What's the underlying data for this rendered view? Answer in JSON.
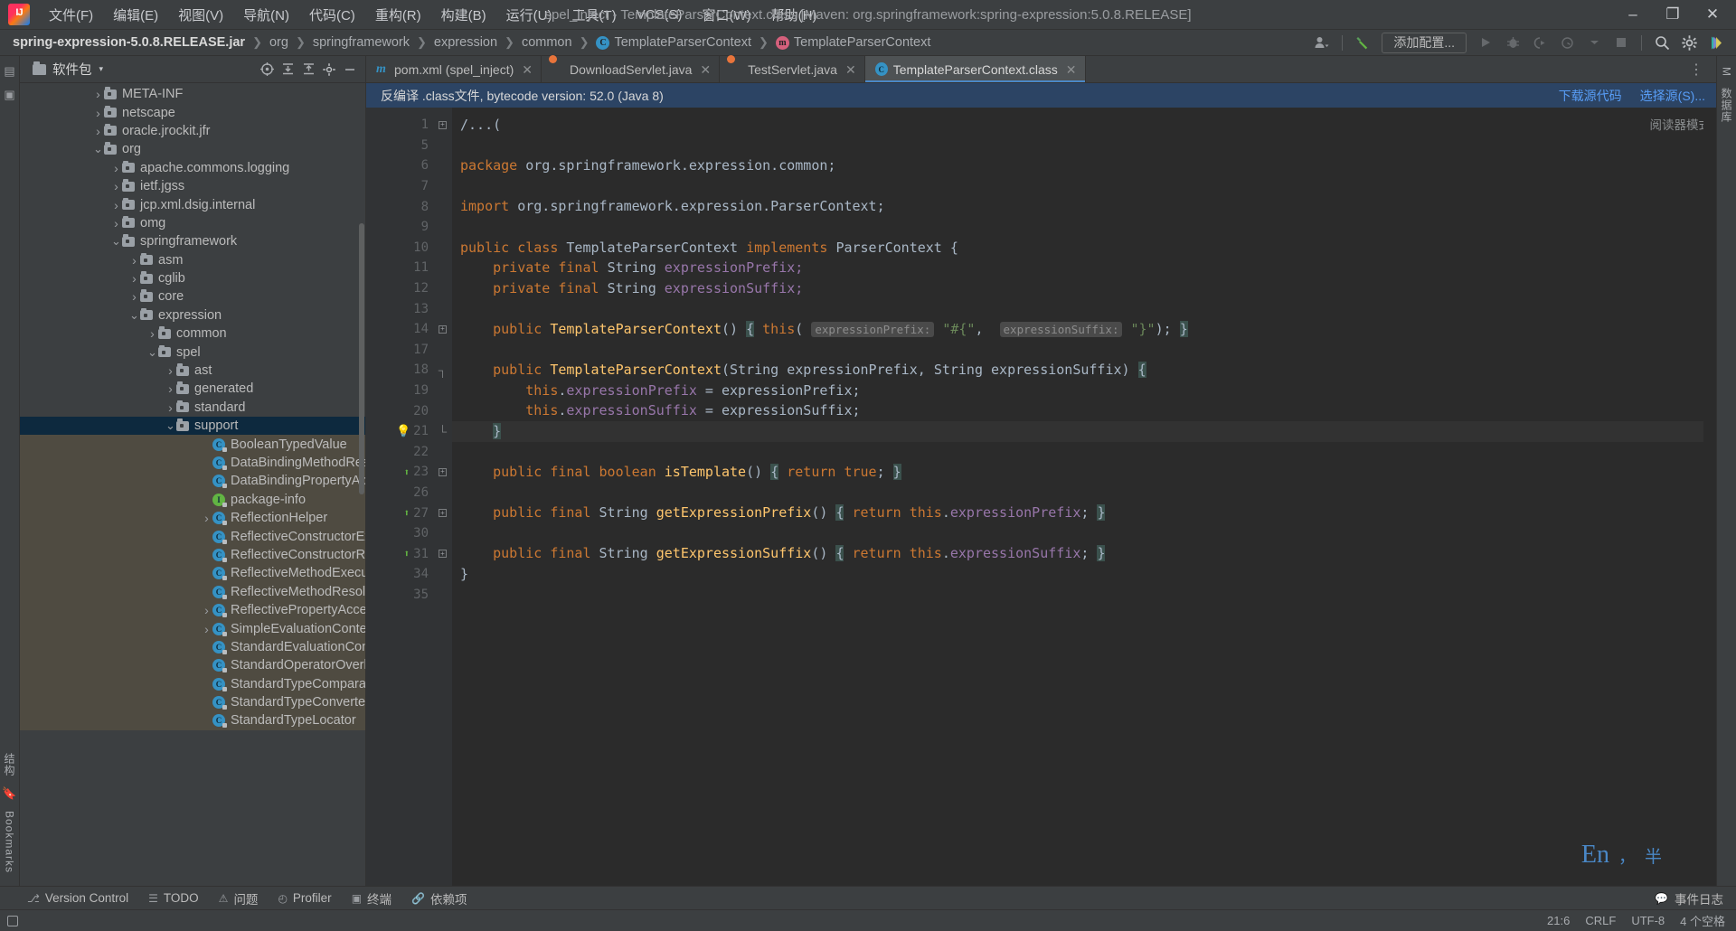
{
  "window": {
    "title": "spel_inject - TemplateParserContext.class [Maven: org.springframework:spring-expression:5.0.8.RELEASE]",
    "minimize": "–",
    "maximize": "❐",
    "close": "✕"
  },
  "menu": {
    "items": [
      {
        "label": "文件(F)"
      },
      {
        "label": "编辑(E)"
      },
      {
        "label": "视图(V)"
      },
      {
        "label": "导航(N)"
      },
      {
        "label": "代码(C)"
      },
      {
        "label": "重构(R)"
      },
      {
        "label": "构建(B)"
      },
      {
        "label": "运行(U)"
      },
      {
        "label": "工具(T)"
      },
      {
        "label": "VCS(S)"
      },
      {
        "label": "窗口(W)"
      },
      {
        "label": "帮助(H)"
      }
    ]
  },
  "navbar": {
    "crumbs": [
      {
        "label": "spring-expression-5.0.8.RELEASE.jar",
        "icon": "none",
        "root": true
      },
      {
        "label": "org",
        "icon": "none"
      },
      {
        "label": "springframework",
        "icon": "none"
      },
      {
        "label": "expression",
        "icon": "none"
      },
      {
        "label": "common",
        "icon": "none"
      },
      {
        "label": "TemplateParserContext",
        "icon": "class-icon",
        "glyph": "C"
      },
      {
        "label": "TemplateParserContext",
        "icon": "method-icon",
        "glyph": "m"
      }
    ],
    "separator": "❯",
    "run_config_label": "添加配置...",
    "buttons": [
      {
        "name": "user-account-icon",
        "glyph": "👤"
      },
      {
        "name": "build-hammer-icon",
        "glyph": "🔨"
      },
      {
        "name": "run-icon",
        "glyph": "▶"
      },
      {
        "name": "debug-icon",
        "glyph": "🐞"
      },
      {
        "name": "run-with-coverage-icon",
        "glyph": "⮕"
      },
      {
        "name": "profile-icon",
        "glyph": "⏱"
      },
      {
        "name": "stop-icon",
        "glyph": "■"
      },
      {
        "name": "search-everywhere-icon",
        "glyph": "🔍"
      },
      {
        "name": "settings-gear-icon",
        "glyph": "⚙"
      },
      {
        "name": "ide-assistant-icon",
        "glyph": "◑"
      }
    ]
  },
  "left_strip": {
    "top_icons": [
      {
        "name": "project-tool-icon",
        "glyph": "▤"
      },
      {
        "name": "commit-tool-icon",
        "glyph": "▣"
      }
    ],
    "bottom_labels": [
      {
        "name": "structure-tool-label",
        "label": "结构"
      },
      {
        "name": "bookmarks-tool-label",
        "label": "Bookmarks"
      }
    ]
  },
  "right_strip": {
    "labels": [
      {
        "name": "maven-tool-label",
        "label": "M"
      },
      {
        "name": "database-tool-label",
        "label": "数据库"
      }
    ]
  },
  "project": {
    "title": "软件包",
    "caret": "▾",
    "actions": [
      {
        "name": "scroll-from-source-icon",
        "glyph": "⊕"
      },
      {
        "name": "collapse-all-icon",
        "glyph": "⤓"
      },
      {
        "name": "expand-all-icon",
        "glyph": "⤑"
      },
      {
        "name": "project-settings-icon",
        "glyph": "⚙"
      },
      {
        "name": "hide-tool-window-icon",
        "glyph": "—"
      }
    ],
    "tree": [
      {
        "label": "META-INF",
        "indent": 2,
        "arrow": "collapsed",
        "type": "folder"
      },
      {
        "label": "netscape",
        "indent": 2,
        "arrow": "collapsed",
        "type": "folder"
      },
      {
        "label": "oracle.jrockit.jfr",
        "indent": 2,
        "arrow": "collapsed",
        "type": "folder"
      },
      {
        "label": "org",
        "indent": 2,
        "arrow": "expanded",
        "type": "folder"
      },
      {
        "label": "apache.commons.logging",
        "indent": 3,
        "arrow": "collapsed",
        "type": "folder"
      },
      {
        "label": "ietf.jgss",
        "indent": 3,
        "arrow": "collapsed",
        "type": "folder"
      },
      {
        "label": "jcp.xml.dsig.internal",
        "indent": 3,
        "arrow": "collapsed",
        "type": "folder"
      },
      {
        "label": "omg",
        "indent": 3,
        "arrow": "collapsed",
        "type": "folder"
      },
      {
        "label": "springframework",
        "indent": 3,
        "arrow": "expanded",
        "type": "folder"
      },
      {
        "label": "asm",
        "indent": 4,
        "arrow": "collapsed",
        "type": "folder"
      },
      {
        "label": "cglib",
        "indent": 4,
        "arrow": "collapsed",
        "type": "folder"
      },
      {
        "label": "core",
        "indent": 4,
        "arrow": "collapsed",
        "type": "folder"
      },
      {
        "label": "expression",
        "indent": 4,
        "arrow": "expanded",
        "type": "folder"
      },
      {
        "label": "common",
        "indent": 5,
        "arrow": "collapsed",
        "type": "folder"
      },
      {
        "label": "spel",
        "indent": 5,
        "arrow": "expanded",
        "type": "folder"
      },
      {
        "label": "ast",
        "indent": 6,
        "arrow": "collapsed",
        "type": "folder"
      },
      {
        "label": "generated",
        "indent": 6,
        "arrow": "collapsed",
        "type": "folder"
      },
      {
        "label": "standard",
        "indent": 6,
        "arrow": "collapsed",
        "type": "folder"
      },
      {
        "label": "support",
        "indent": 6,
        "arrow": "expanded",
        "type": "folder",
        "selected": true
      },
      {
        "label": "BooleanTypedValue",
        "indent": 8,
        "arrow": "none",
        "type": "class",
        "lib": true
      },
      {
        "label": "DataBindingMethodResolver",
        "indent": 8,
        "arrow": "none",
        "type": "class",
        "lib": true
      },
      {
        "label": "DataBindingPropertyAccessor",
        "indent": 8,
        "arrow": "none",
        "type": "class",
        "lib": true
      },
      {
        "label": "package-info",
        "indent": 8,
        "arrow": "none",
        "type": "iface",
        "lib": true
      },
      {
        "label": "ReflectionHelper",
        "indent": 8,
        "arrow": "collapsed",
        "type": "class",
        "lib": true
      },
      {
        "label": "ReflectiveConstructorExecutor",
        "indent": 8,
        "arrow": "none",
        "type": "class",
        "lib": true
      },
      {
        "label": "ReflectiveConstructorResolver",
        "indent": 8,
        "arrow": "none",
        "type": "class",
        "lib": true
      },
      {
        "label": "ReflectiveMethodExecutor",
        "indent": 8,
        "arrow": "none",
        "type": "class",
        "lib": true
      },
      {
        "label": "ReflectiveMethodResolver",
        "indent": 8,
        "arrow": "none",
        "type": "class",
        "lib": true
      },
      {
        "label": "ReflectivePropertyAccessor",
        "indent": 8,
        "arrow": "collapsed",
        "type": "class",
        "lib": true
      },
      {
        "label": "SimpleEvaluationContext",
        "indent": 8,
        "arrow": "collapsed",
        "type": "class",
        "lib": true
      },
      {
        "label": "StandardEvaluationContext",
        "indent": 8,
        "arrow": "none",
        "type": "class",
        "lib": true
      },
      {
        "label": "StandardOperatorOverloader",
        "indent": 8,
        "arrow": "none",
        "type": "class",
        "lib": true
      },
      {
        "label": "StandardTypeComparator",
        "indent": 8,
        "arrow": "none",
        "type": "class",
        "lib": true
      },
      {
        "label": "StandardTypeConverter",
        "indent": 8,
        "arrow": "none",
        "type": "class",
        "lib": true
      },
      {
        "label": "StandardTypeLocator",
        "indent": 8,
        "arrow": "none",
        "type": "class",
        "lib": true
      }
    ]
  },
  "editor": {
    "tabs": [
      {
        "label": "pom.xml (spel_inject)",
        "icon": "maven-icon",
        "active": false,
        "close": "✕"
      },
      {
        "label": "DownloadServlet.java",
        "icon": "java-icon",
        "active": false,
        "close": "✕"
      },
      {
        "label": "TestServlet.java",
        "icon": "java-icon",
        "active": false,
        "close": "✕"
      },
      {
        "label": "TemplateParserContext.class",
        "icon": "class-icon",
        "active": true,
        "close": "✕"
      }
    ],
    "tab_overflow": "⋮",
    "notice": {
      "text": "反编译 .class文件, bytecode version: 52.0 (Java 8)",
      "links": [
        {
          "label": "下载源代码"
        },
        {
          "label": "选择源(S)..."
        }
      ]
    },
    "reader_mode": "阅读器模式",
    "lines": [
      {
        "num": "1",
        "fold": "plus",
        "tokens": [
          {
            "t": "/...(",
            "c": "fold"
          }
        ]
      },
      {
        "num": "5",
        "fold": "",
        "tokens": []
      },
      {
        "num": "6",
        "fold": "",
        "tokens": [
          {
            "t": "package ",
            "c": "kw"
          },
          {
            "t": "org.springframework.expression.common;",
            "c": "plain"
          }
        ]
      },
      {
        "num": "7",
        "fold": "",
        "tokens": []
      },
      {
        "num": "8",
        "fold": "",
        "tokens": [
          {
            "t": "import ",
            "c": "kw"
          },
          {
            "t": "org.springframework.expression.ParserContext;",
            "c": "plain"
          }
        ]
      },
      {
        "num": "9",
        "fold": "",
        "tokens": []
      },
      {
        "num": "10",
        "fold": "",
        "tokens": [
          {
            "t": "public class ",
            "c": "kw"
          },
          {
            "t": "TemplateParserContext ",
            "c": "cls"
          },
          {
            "t": "implements ",
            "c": "kw"
          },
          {
            "t": "ParserContext {",
            "c": "plain"
          }
        ]
      },
      {
        "num": "11",
        "fold": "",
        "tokens": [
          {
            "t": "    private final ",
            "c": "kw"
          },
          {
            "t": "String ",
            "c": "cls"
          },
          {
            "t": "expressionPrefix;",
            "c": "fld"
          }
        ]
      },
      {
        "num": "12",
        "fold": "",
        "tokens": [
          {
            "t": "    private final ",
            "c": "kw"
          },
          {
            "t": "String ",
            "c": "cls"
          },
          {
            "t": "expressionSuffix;",
            "c": "fld"
          }
        ]
      },
      {
        "num": "13",
        "fold": "",
        "tokens": []
      },
      {
        "num": "14",
        "fold": "plus",
        "tokens": [
          {
            "t": "    public ",
            "c": "kw"
          },
          {
            "t": "TemplateParserContext",
            "c": "mth"
          },
          {
            "t": "() ",
            "c": "plain"
          },
          {
            "t": "{",
            "c": "brace"
          },
          {
            "t": " ",
            "c": "plain"
          },
          {
            "t": "this",
            "c": "kw"
          },
          {
            "t": "( ",
            "c": "plain"
          },
          {
            "t": "expressionPrefix:",
            "c": "hint"
          },
          {
            "t": " ",
            "c": "plain"
          },
          {
            "t": "\"#{\"",
            "c": "str"
          },
          {
            "t": ",  ",
            "c": "plain"
          },
          {
            "t": "expressionSuffix:",
            "c": "hint"
          },
          {
            "t": " ",
            "c": "plain"
          },
          {
            "t": "\"}\"",
            "c": "str"
          },
          {
            "t": "); ",
            "c": "plain"
          },
          {
            "t": "}",
            "c": "brace"
          }
        ]
      },
      {
        "num": "17",
        "fold": "",
        "tokens": []
      },
      {
        "num": "18",
        "fold": "brace",
        "tokens": [
          {
            "t": "    public ",
            "c": "kw"
          },
          {
            "t": "TemplateParserContext",
            "c": "mth"
          },
          {
            "t": "(",
            "c": "plain"
          },
          {
            "t": "String ",
            "c": "cls"
          },
          {
            "t": "expressionPrefix, ",
            "c": "plain"
          },
          {
            "t": "String ",
            "c": "cls"
          },
          {
            "t": "expressionSuffix) ",
            "c": "plain"
          },
          {
            "t": "{",
            "c": "brace"
          }
        ]
      },
      {
        "num": "19",
        "fold": "",
        "tokens": [
          {
            "t": "        this",
            "c": "kw"
          },
          {
            "t": ".",
            "c": "plain"
          },
          {
            "t": "expressionPrefix",
            "c": "fld"
          },
          {
            "t": " = expressionPrefix;",
            "c": "plain"
          }
        ]
      },
      {
        "num": "20",
        "fold": "",
        "tokens": [
          {
            "t": "        this",
            "c": "kw"
          },
          {
            "t": ".",
            "c": "plain"
          },
          {
            "t": "expressionSuffix",
            "c": "fld"
          },
          {
            "t": " = expressionSuffix;",
            "c": "plain"
          }
        ]
      },
      {
        "num": "21",
        "fold": "braceEnd",
        "bulb": true,
        "current": true,
        "tokens": [
          {
            "t": "    ",
            "c": "plain"
          },
          {
            "t": "}",
            "c": "brace"
          }
        ]
      },
      {
        "num": "22",
        "fold": "",
        "tokens": []
      },
      {
        "num": "23",
        "fold": "plus",
        "override": true,
        "tokens": [
          {
            "t": "    public final ",
            "c": "kw"
          },
          {
            "t": "boolean ",
            "c": "kw"
          },
          {
            "t": "isTemplate",
            "c": "mth"
          },
          {
            "t": "() ",
            "c": "plain"
          },
          {
            "t": "{",
            "c": "brace"
          },
          {
            "t": " ",
            "c": "plain"
          },
          {
            "t": "return true",
            "c": "kw"
          },
          {
            "t": "; ",
            "c": "plain"
          },
          {
            "t": "}",
            "c": "brace"
          }
        ]
      },
      {
        "num": "26",
        "fold": "",
        "tokens": []
      },
      {
        "num": "27",
        "fold": "plus",
        "override": true,
        "tokens": [
          {
            "t": "    public final ",
            "c": "kw"
          },
          {
            "t": "String ",
            "c": "cls"
          },
          {
            "t": "getExpressionPrefix",
            "c": "mth"
          },
          {
            "t": "() ",
            "c": "plain"
          },
          {
            "t": "{",
            "c": "brace"
          },
          {
            "t": " ",
            "c": "plain"
          },
          {
            "t": "return ",
            "c": "kw"
          },
          {
            "t": "this",
            "c": "kw"
          },
          {
            "t": ".",
            "c": "plain"
          },
          {
            "t": "expressionPrefix",
            "c": "fld"
          },
          {
            "t": "; ",
            "c": "plain"
          },
          {
            "t": "}",
            "c": "brace"
          }
        ]
      },
      {
        "num": "30",
        "fold": "",
        "tokens": []
      },
      {
        "num": "31",
        "fold": "plus",
        "override": true,
        "tokens": [
          {
            "t": "    public final ",
            "c": "kw"
          },
          {
            "t": "String ",
            "c": "cls"
          },
          {
            "t": "getExpressionSuffix",
            "c": "mth"
          },
          {
            "t": "() ",
            "c": "plain"
          },
          {
            "t": "{",
            "c": "brace"
          },
          {
            "t": " ",
            "c": "plain"
          },
          {
            "t": "return ",
            "c": "kw"
          },
          {
            "t": "this",
            "c": "kw"
          },
          {
            "t": ".",
            "c": "plain"
          },
          {
            "t": "expressionSuffix",
            "c": "fld"
          },
          {
            "t": "; ",
            "c": "plain"
          },
          {
            "t": "}",
            "c": "brace"
          }
        ]
      },
      {
        "num": "34",
        "fold": "",
        "tokens": [
          {
            "t": "}",
            "c": "plain"
          }
        ]
      },
      {
        "num": "35",
        "fold": "",
        "tokens": []
      }
    ],
    "ime": {
      "lang": "En",
      "punct": "，",
      "width": "半"
    }
  },
  "bottom_bar": {
    "items": [
      {
        "name": "version-control-tab",
        "label": "Version Control",
        "glyph": "⎇"
      },
      {
        "name": "todo-tab",
        "label": "TODO",
        "glyph": "☰"
      },
      {
        "name": "problems-tab",
        "label": "问题",
        "glyph": "⚠"
      },
      {
        "name": "profiler-tab",
        "label": "Profiler",
        "glyph": "◴"
      },
      {
        "name": "terminal-tab",
        "label": "终端",
        "glyph": "▣"
      },
      {
        "name": "dependencies-tab",
        "label": "依赖项",
        "glyph": "🔗"
      }
    ],
    "right": {
      "event_log_label": "事件日志",
      "event_log_glyph": "💬"
    }
  },
  "status_bar": {
    "position": "21:6",
    "line_separator": "CRLF",
    "encoding": "UTF-8",
    "indent": "4 个空格",
    "left_icon": "□"
  }
}
